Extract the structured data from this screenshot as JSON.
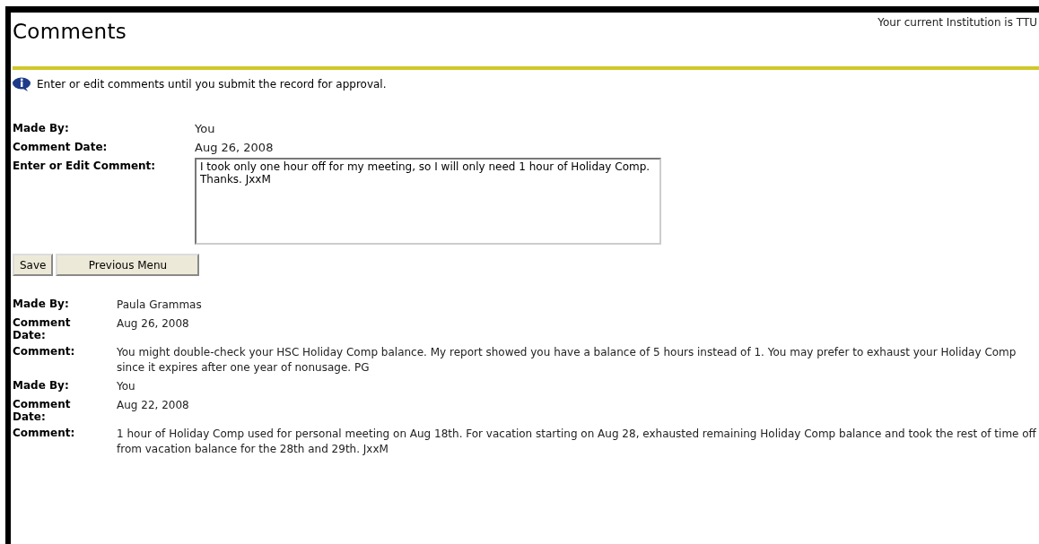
{
  "header": {
    "title": "Comments",
    "institution": "Your current Institution is TTU"
  },
  "info": "Enter or edit comments until you submit the record for approval.",
  "form": {
    "made_by_label": "Made By:",
    "made_by": "You",
    "date_label": "Comment Date:",
    "date": "Aug 26, 2008",
    "comment_label": "Enter or Edit Comment:",
    "comment": "I took only one hour off for my meeting, so I will only need 1 hour of Holiday Comp.  Thanks. JxxM"
  },
  "buttons": [
    "Save",
    "Previous Menu"
  ],
  "comments": [
    {
      "made_by_label": "Made By:",
      "made_by": "Paula Grammas",
      "date_label": "Comment Date:",
      "date": "Aug 26, 2008",
      "comment_label": "Comment:",
      "comment": "You might double-check your HSC Holiday Comp balance. My report showed you have a balance of 5 hours instead of 1. You may prefer to exhaust your Holiday Comp since it expires after one year of nonusage. PG"
    },
    {
      "made_by_label": "Made By:",
      "made_by": "You",
      "date_label": "Comment Date:",
      "date": "Aug 22, 2008",
      "comment_label": "Comment:",
      "comment": "1 hour of Holiday Comp used for personal meeting on Aug 18th. For vacation starting on Aug 28, exhausted remaining Holiday Comp balance and took the rest of time off from vacation balance for the 28th and 29th. JxxM"
    }
  ]
}
